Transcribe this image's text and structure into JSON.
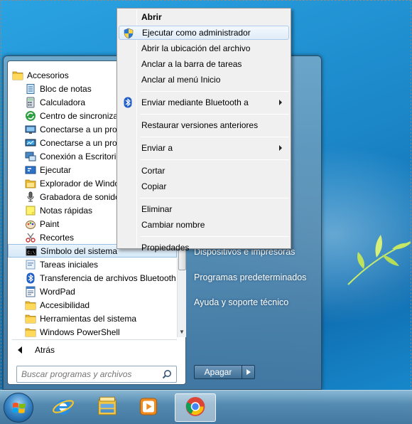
{
  "start_menu": {
    "programs": [
      {
        "label": "Accesorios",
        "icon": "folder-icon"
      },
      {
        "label": "Bloc de notas",
        "icon": "notepad-icon"
      },
      {
        "label": "Calculadora",
        "icon": "calculator-icon"
      },
      {
        "label": "Centro de sincronización",
        "icon": "sync-center-icon"
      },
      {
        "label": "Conectarse a un proyector",
        "icon": "projector-icon"
      },
      {
        "label": "Conectarse a un proyector de red",
        "icon": "network-projector-icon"
      },
      {
        "label": "Conexión a Escritorio remoto",
        "icon": "remote-desktop-icon"
      },
      {
        "label": "Ejecutar",
        "icon": "run-icon"
      },
      {
        "label": "Explorador de Windows",
        "icon": "explorer-icon"
      },
      {
        "label": "Grabadora de sonidos",
        "icon": "microphone-icon"
      },
      {
        "label": "Notas rápidas",
        "icon": "sticky-notes-icon"
      },
      {
        "label": "Paint",
        "icon": "paint-icon"
      },
      {
        "label": "Recortes",
        "icon": "snipping-icon"
      },
      {
        "label": "Símbolo del sistema",
        "icon": "cmd-icon"
      },
      {
        "label": "Tareas iniciales",
        "icon": "getting-started-icon"
      },
      {
        "label": "Transferencia de archivos Bluetooth",
        "icon": "bluetooth-icon"
      },
      {
        "label": "WordPad",
        "icon": "wordpad-icon"
      },
      {
        "label": "Accesibilidad",
        "icon": "folder-icon"
      },
      {
        "label": "Herramientas del sistema",
        "icon": "folder-icon"
      },
      {
        "label": "Windows PowerShell",
        "icon": "folder-icon"
      }
    ],
    "selected_program": "Símbolo del sistema",
    "back_label": "Atrás",
    "search_placeholder": "Buscar programas y archivos",
    "right_links": [
      "Dispositivos e impresoras",
      "Programas predeterminados",
      "Ayuda y soporte técnico"
    ],
    "shutdown_label": "Apagar"
  },
  "context_menu": {
    "groups": [
      [
        {
          "label": "Abrir",
          "bold": true
        },
        {
          "label": "Ejecutar como administrador",
          "icon": "uac-shield-icon",
          "highlighted": true
        },
        {
          "label": "Abrir la ubicación del archivo"
        },
        {
          "label": "Anclar a la barra de tareas"
        },
        {
          "label": "Anclar al menú Inicio"
        }
      ],
      [
        {
          "label": "Enviar mediante Bluetooth a",
          "icon": "bluetooth-icon",
          "submenu": true
        }
      ],
      [
        {
          "label": "Restaurar versiones anteriores"
        }
      ],
      [
        {
          "label": "Enviar a",
          "submenu": true
        }
      ],
      [
        {
          "label": "Cortar"
        },
        {
          "label": "Copiar"
        }
      ],
      [
        {
          "label": "Eliminar"
        },
        {
          "label": "Cambiar nombre"
        }
      ],
      [
        {
          "label": "Propiedades"
        }
      ]
    ]
  },
  "taskbar": {
    "items": [
      {
        "icon": "internet-explorer-icon"
      },
      {
        "icon": "file-explorer-icon"
      },
      {
        "icon": "media-player-icon"
      },
      {
        "icon": "chrome-icon",
        "active": true
      }
    ]
  },
  "colors": {
    "highlight_border": "#aecbef",
    "desktop_blue": "#1b86c8",
    "selection_blue": "#98c0e4"
  }
}
